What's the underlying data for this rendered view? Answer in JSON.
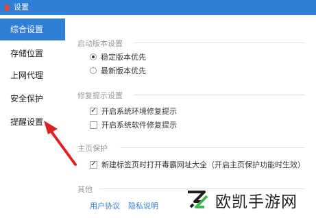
{
  "window": {
    "title": "设置"
  },
  "sidebar": {
    "items": [
      {
        "label": "综合设置",
        "active": true
      },
      {
        "label": "存储位置",
        "active": false
      },
      {
        "label": "上网代理",
        "active": false
      },
      {
        "label": "安全保护",
        "active": false
      },
      {
        "label": "提醒设置",
        "active": false
      }
    ]
  },
  "sections": {
    "startup": {
      "title": "启动版本设置",
      "options": [
        {
          "label": "稳定版本优先",
          "checked": true
        },
        {
          "label": "最新版本优先",
          "checked": false
        }
      ]
    },
    "repair": {
      "title": "修复提示设置",
      "options": [
        {
          "label": "开启系统环境修复提示",
          "checked": true
        },
        {
          "label": "开启系统软件修复提示",
          "checked": false
        }
      ]
    },
    "homepage": {
      "title": "主页保护",
      "options": [
        {
          "label": "新建标签页时打开毒霸网址大全（开启主页保护功能时生效）",
          "checked": true
        }
      ]
    },
    "other": {
      "title": "其他",
      "links": [
        {
          "label": "用户协议"
        },
        {
          "label": "隐私说明"
        }
      ]
    }
  },
  "watermark": {
    "text": "欧凯手游网"
  },
  "colors": {
    "accent": "#2f7fd6",
    "arrow": "#e02020"
  }
}
